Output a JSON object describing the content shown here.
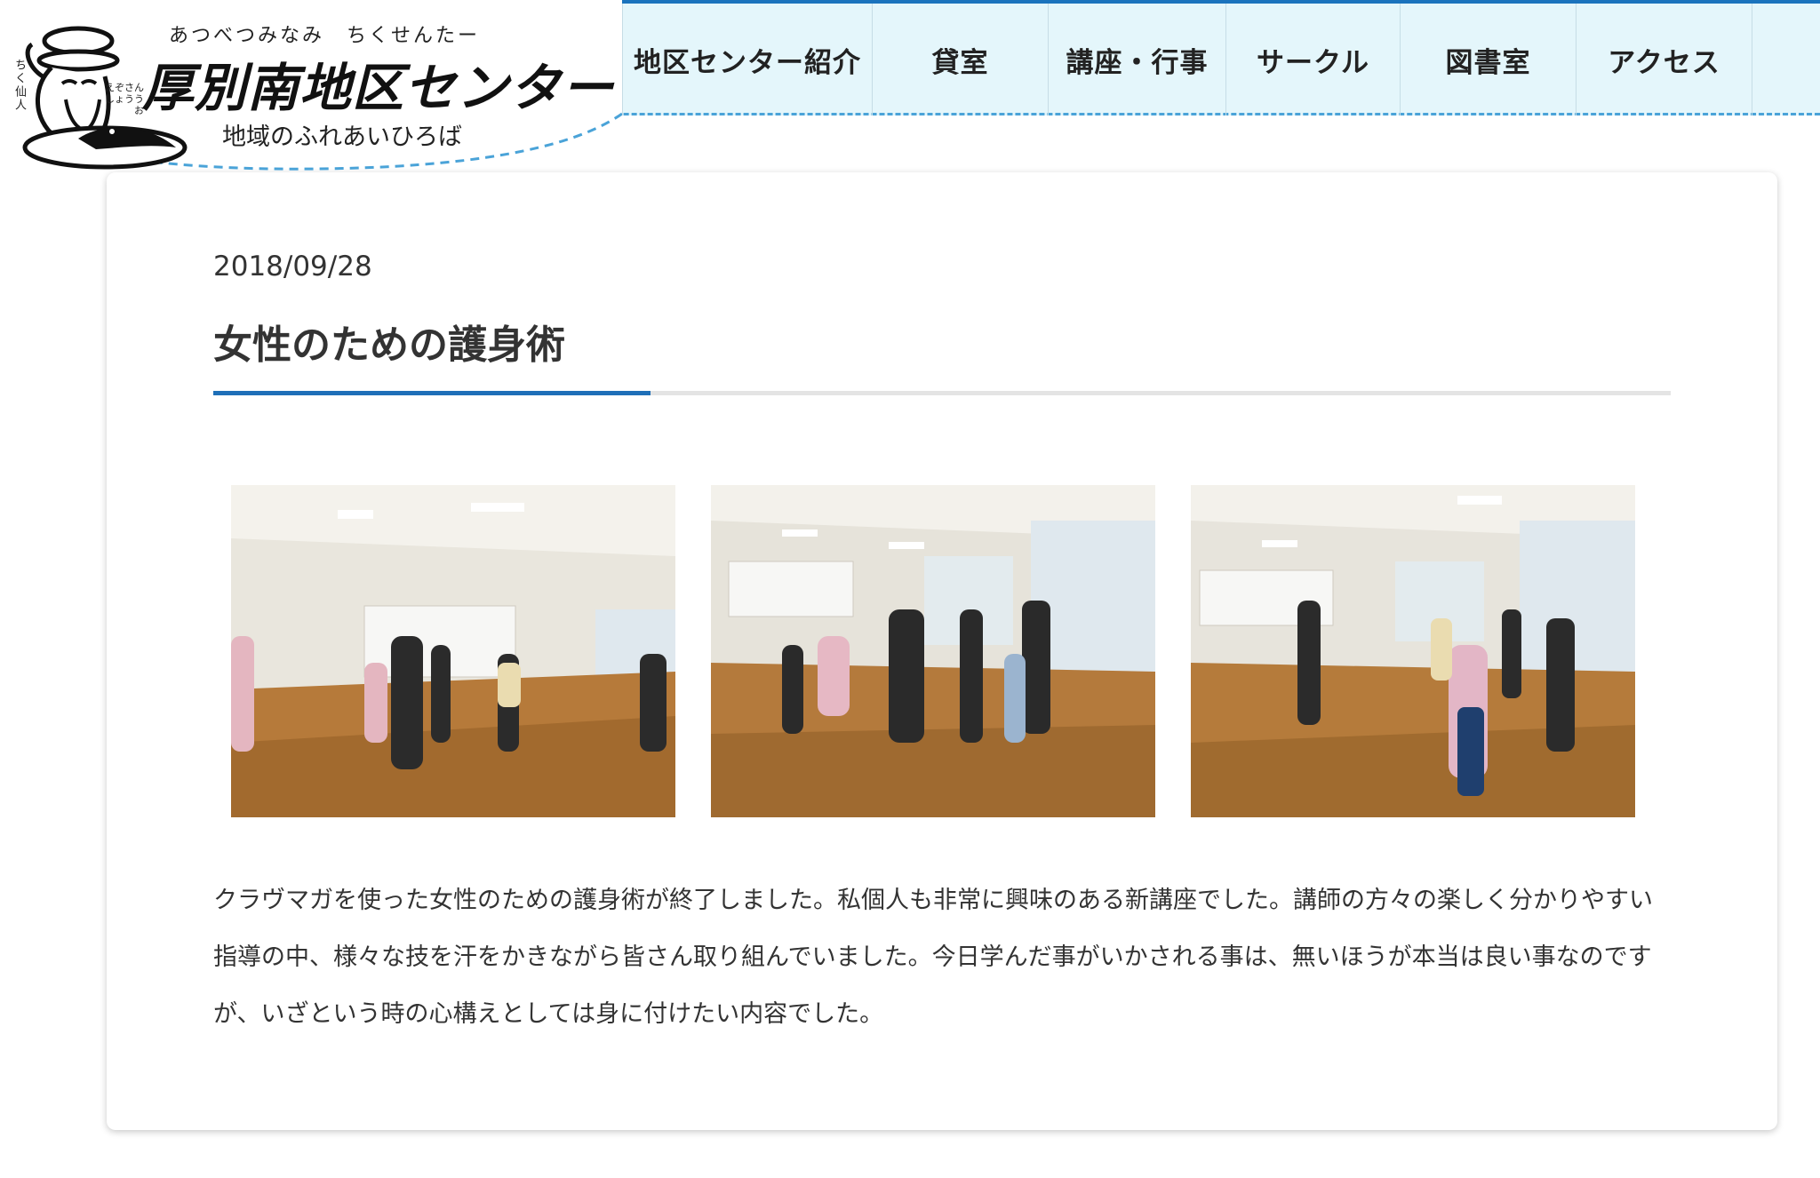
{
  "site": {
    "ruby": "あつべつみなみ　ちくせんたー",
    "title": "厚別南地区センター",
    "subtitle": "地域のふれあいひろば",
    "side_label": "ちく仙人",
    "mascot_label": "えぞさんしょううお"
  },
  "nav": {
    "items": [
      {
        "label": "地区センター紹介"
      },
      {
        "label": "貸室"
      },
      {
        "label": "講座・行事"
      },
      {
        "label": "サークル"
      },
      {
        "label": "図書室"
      },
      {
        "label": "アクセス"
      }
    ]
  },
  "post": {
    "date": "2018/09/28",
    "title": "女性のための護身術",
    "body": "クラヴマガを使った女性のための護身術が終了しました。私個人も非常に興味のある新講座でした。講師の方々の楽しく分かりやすい指導の中、様々な技を汗をかきながら皆さん取り組んでいました。今日学んだ事がいかされる事は、無いほうが本当は良い事なのですが、いざという時の心構えとしては身に付けたい内容でした。"
  },
  "colors": {
    "header_bg": "#e4f6fb",
    "accent": "#1e6fb8",
    "dash": "#4aa3d8"
  }
}
